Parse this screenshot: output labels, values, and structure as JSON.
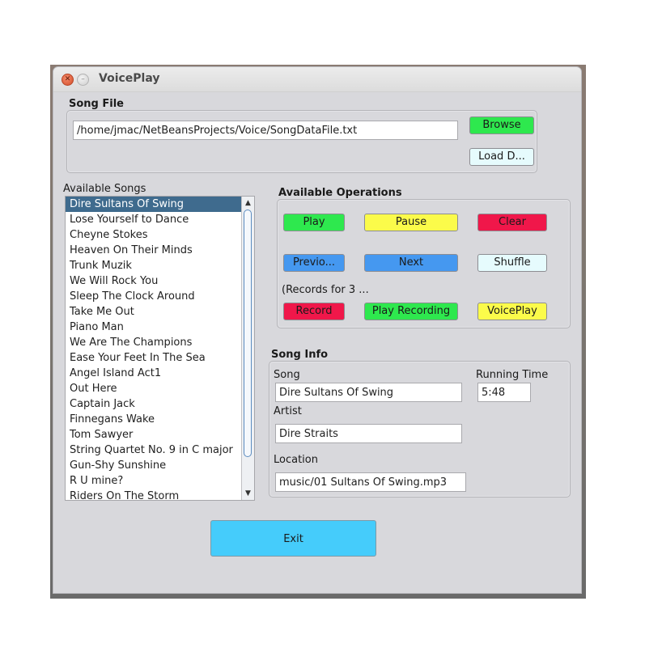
{
  "window": {
    "title": "VoicePlay"
  },
  "song_file": {
    "label": "Song File",
    "path": "/home/jmac/NetBeansProjects/Voice/SongDataFile.txt",
    "browse_label": "Browse",
    "load_label": "Load D..."
  },
  "songs": {
    "label": "Available Songs",
    "selected": "Dire Sultans Of Swing",
    "items": [
      "Dire Sultans Of Swing",
      "Lose Yourself to Dance",
      "Cheyne Stokes",
      "Heaven On Their Minds",
      "Trunk Muzik",
      "We Will Rock You",
      "Sleep The Clock Around",
      "Take Me Out",
      "Piano Man",
      "We Are The Champions",
      "Ease Your Feet In The Sea",
      "Angel Island Act1",
      "Out Here",
      "Captain Jack",
      "Finnegans Wake",
      "Tom Sawyer",
      "String Quartet No. 9 in C major",
      "Gun-Shy Sunshine",
      "R U mine?",
      "Riders On The Storm"
    ]
  },
  "operations": {
    "label": "Available Operations",
    "play": "Play",
    "pause": "Pause",
    "clear": "Clear",
    "previous": "Previo...",
    "next": "Next",
    "shuffle": "Shuffle",
    "records_note": "(Records for 3 ...",
    "record": "Record",
    "play_recording": "Play Recording",
    "voiceplay": "VoicePlay"
  },
  "song_info": {
    "label": "Song Info",
    "song_label": "Song",
    "song_value": "Dire Sultans Of Swing",
    "running_time_label": "Running Time",
    "running_time_value": "5:48",
    "artist_label": "Artist",
    "artist_value": "Dire Straits",
    "location_label": "Location",
    "location_value": "music/01 Sultans Of Swing.mp3"
  },
  "exit_label": "Exit",
  "colors": {
    "green": "#2ee84e",
    "yellow": "#fbfb4a",
    "red": "#f0174a",
    "blue": "#4598f0",
    "pale_cyan": "#e6fbfd",
    "exit": "#45ccfb",
    "selection": "#3f6b8e"
  }
}
